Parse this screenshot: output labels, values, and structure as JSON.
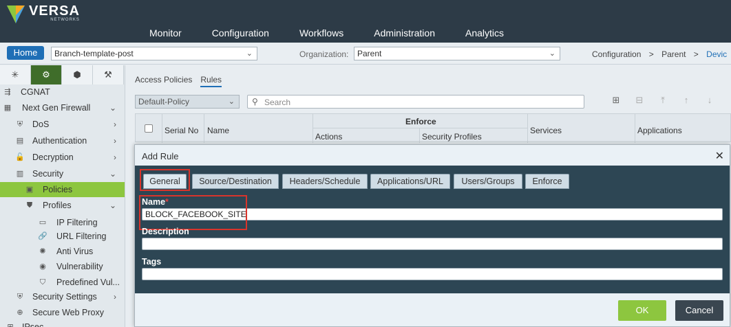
{
  "brand": {
    "name": "VERSA",
    "sub": "NETWORKS",
    "color": "#2d3b47"
  },
  "nav": [
    "Monitor",
    "Configuration",
    "Workflows",
    "Administration",
    "Analytics"
  ],
  "bar": {
    "home": "Home",
    "template": "Branch-template-post",
    "org_label": "Organization:",
    "org_value": "Parent",
    "breadcrumb": [
      "Configuration",
      ">",
      "Parent",
      ">",
      "Devic"
    ]
  },
  "sidebar": {
    "tabs": [
      "network-icon",
      "gear-icon",
      "cube-icon",
      "tools-icon"
    ],
    "items": [
      {
        "label": "CGNAT",
        "icon": "cgnat-icon"
      },
      {
        "label": "Next Gen Firewall",
        "icon": "firewall-icon",
        "chevron": "⌄"
      },
      {
        "label": "DoS",
        "icon": "dos-icon",
        "chevron": "›"
      },
      {
        "label": "Authentication",
        "icon": "authentication-icon",
        "chevron": "›"
      },
      {
        "label": "Decryption",
        "icon": "decryption-icon",
        "chevron": "›"
      },
      {
        "label": "Security",
        "icon": "security-icon",
        "chevron": "⌄"
      },
      {
        "label": "Policies",
        "icon": "policies-icon"
      },
      {
        "label": "Profiles",
        "icon": "profiles-icon",
        "chevron": "⌄"
      },
      {
        "label": "IP Filtering",
        "icon": "ip-filter-icon"
      },
      {
        "label": "URL Filtering",
        "icon": "url-filter-icon"
      },
      {
        "label": "Anti Virus",
        "icon": "antivirus-icon"
      },
      {
        "label": "Vulnerability",
        "icon": "vulnerability-icon"
      },
      {
        "label": "Predefined Vul...",
        "icon": "predefined-icon"
      },
      {
        "label": "Security Settings",
        "icon": "security-settings-icon",
        "chevron": "›"
      },
      {
        "label": "Secure Web Proxy",
        "icon": "proxy-icon"
      },
      {
        "label": "IPsec",
        "icon": "ipsec-icon"
      }
    ]
  },
  "content": {
    "tabs": [
      "Access Policies",
      "Rules"
    ],
    "policy_select": "Default-Policy",
    "search_placeholder": "Search",
    "table": {
      "serial": "Serial No",
      "name": "Name",
      "enforce": "Enforce",
      "actions": "Actions",
      "security_profiles": "Security Profiles",
      "services": "Services",
      "applications": "Applications"
    }
  },
  "modal": {
    "title": "Add Rule",
    "close": "✕",
    "tabs": [
      "General",
      "Source/Destination",
      "Headers/Schedule",
      "Applications/URL",
      "Users/Groups",
      "Enforce"
    ],
    "name_label": "Name",
    "required_mark": "*",
    "name_value": "BLOCK_FACEBOOK_SITE",
    "description_label": "Description",
    "description_value": "",
    "tags_label": "Tags",
    "tags_value": "",
    "ok": "OK",
    "cancel": "Cancel"
  },
  "colors": {
    "accent": "#8dc63f",
    "primary": "#1f6fb6",
    "highlight": "#d9342b"
  }
}
